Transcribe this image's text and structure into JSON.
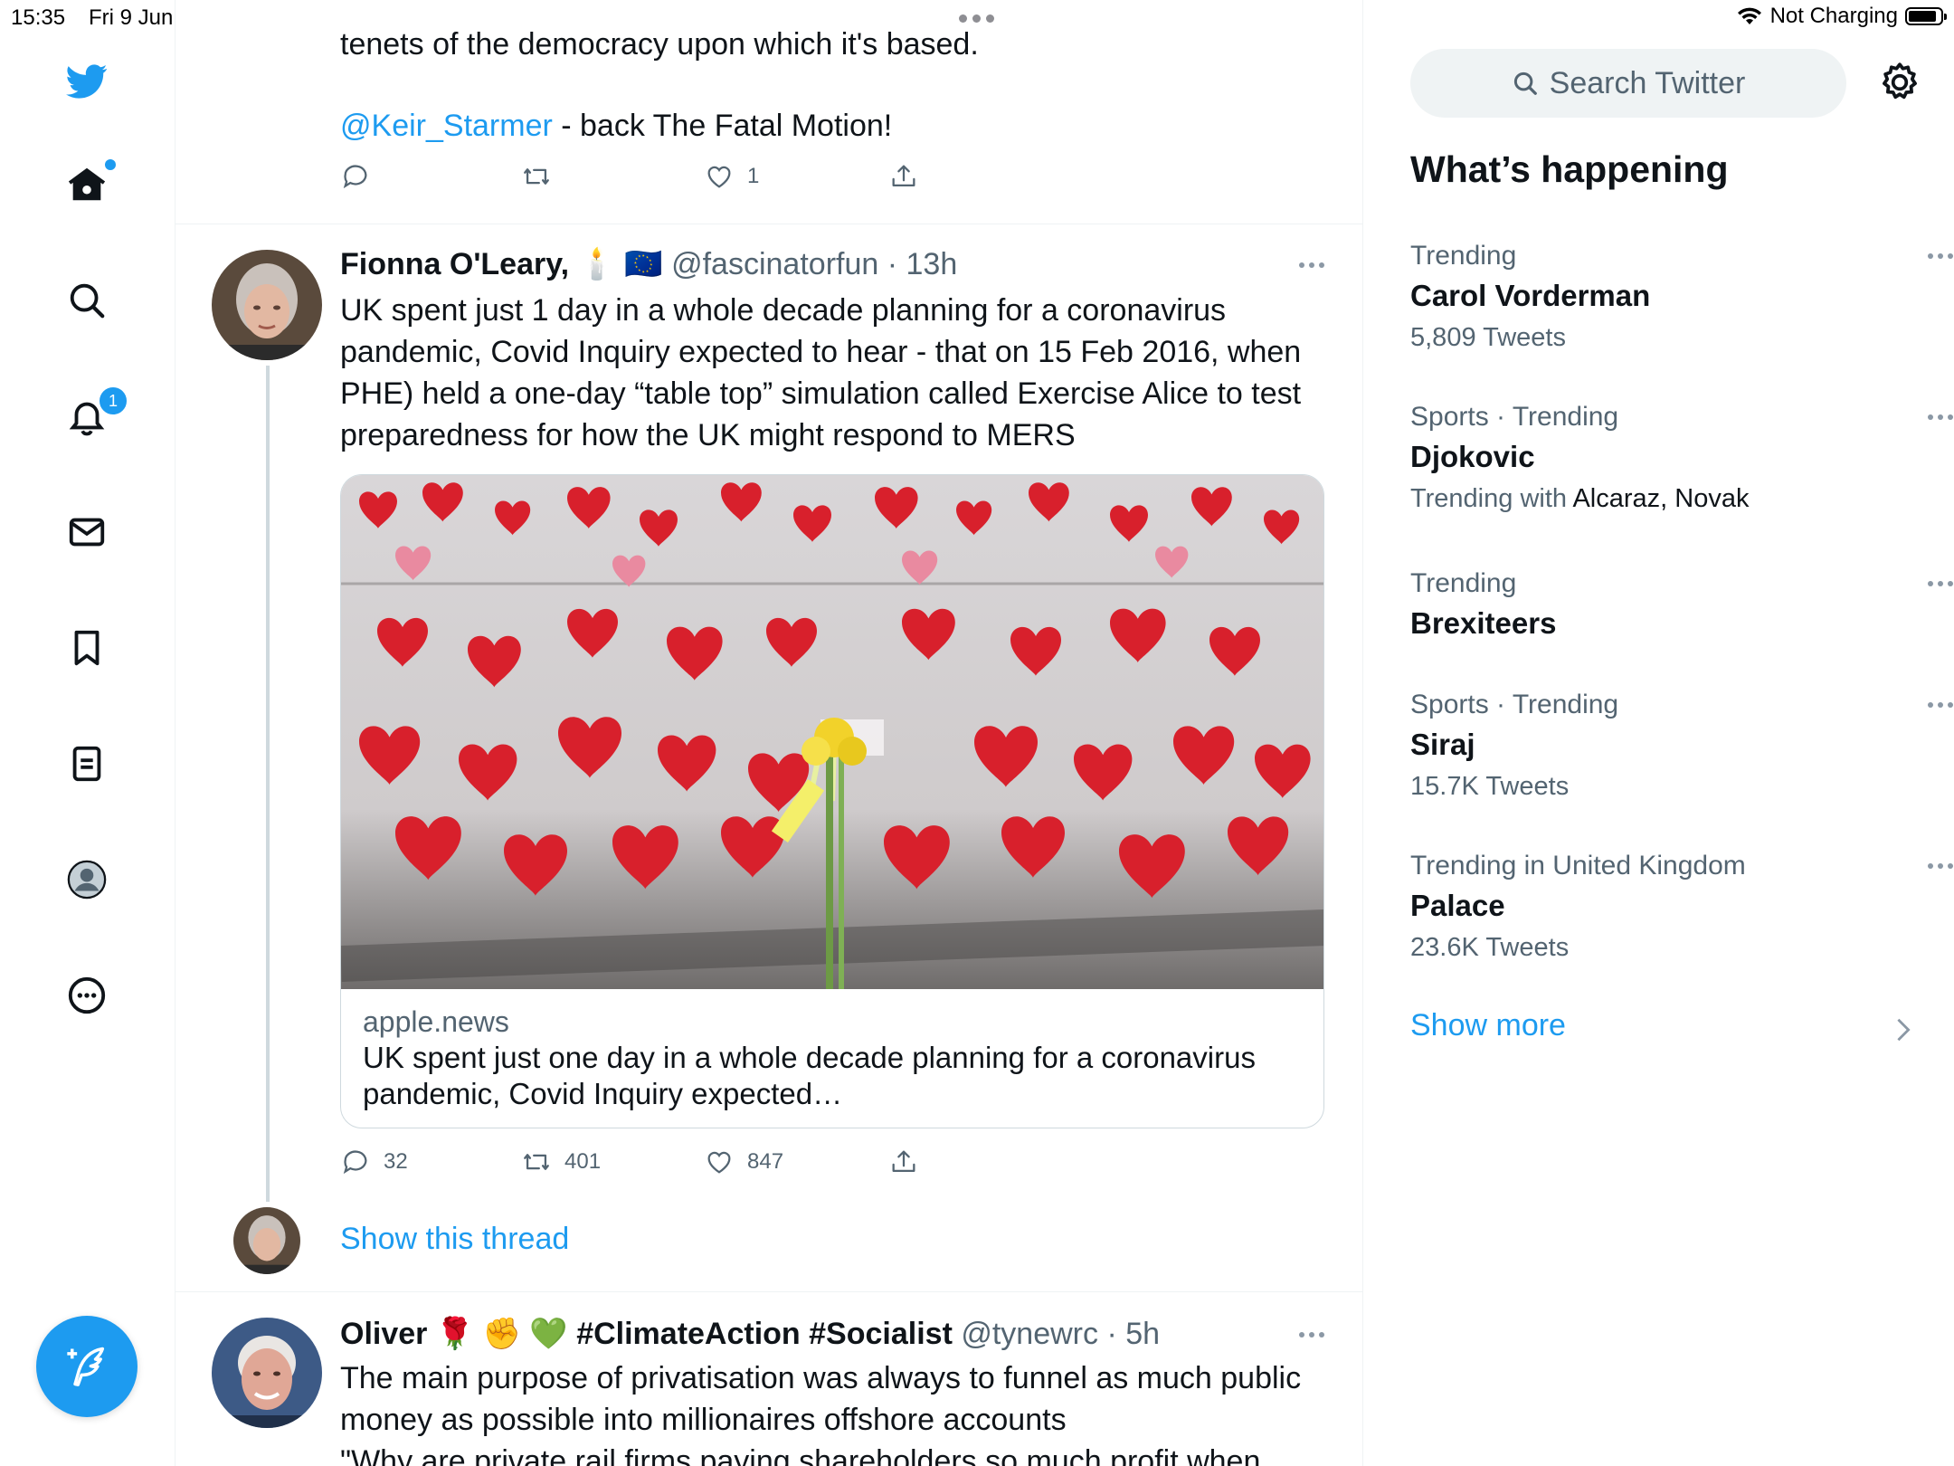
{
  "status": {
    "time": "15:35",
    "date": "Fri 9 Jun",
    "charging": "Not Charging"
  },
  "nav": {
    "notifications_badge": "1",
    "icons": [
      "twitter-logo-icon",
      "home-icon",
      "search-icon",
      "bell-icon",
      "mail-icon",
      "bookmark-icon",
      "lists-icon",
      "profile-icon",
      "more-circle-icon",
      "compose-icon"
    ]
  },
  "tweets": {
    "prev": {
      "text_line": "tenets of the democracy upon which it's based.",
      "mention": "@Keir_Starmer",
      "mention_rest": " - back The Fatal Motion!",
      "likes": "1"
    },
    "main": {
      "name": "Fionna O'Leary,",
      "emoji": "🕯️ 🇪🇺",
      "handle": "@fascinatorfun",
      "time": "13h",
      "text": "UK spent just 1 day in a whole decade planning for a coronavirus pandemic, Covid Inquiry expected to hear - that on 15 Feb 2016, when PHE) held a one-day “table top” simulation called Exercise Alice to test preparedness for how the UK might respond to MERS",
      "card_domain": "apple.news",
      "card_title": "UK spent just one day in a whole decade planning for a coronavirus pandemic, Covid Inquiry expected…",
      "replies": "32",
      "retweets": "401",
      "likes": "847",
      "show_thread": "Show this thread"
    },
    "next": {
      "name": "Oliver",
      "emoji": "🌹 ✊ 💚",
      "tags": "#ClimateAction #Socialist",
      "handle": "@tynewrc",
      "time": "5h",
      "text": "The main purpose of privatisation was always to funnel as much public money as possible into millionaires offshore accounts",
      "text2": "\"Why are private rail firms paying shareholders so much profit when"
    }
  },
  "sidebar": {
    "search_placeholder": "Search Twitter",
    "title": "What’s happening",
    "trends": [
      {
        "context": "Trending",
        "name": "Carol Vorderman",
        "count": "5,809 Tweets"
      },
      {
        "context": "Sports · Trending",
        "name": "Djokovic",
        "count_prefix": "Trending with ",
        "count_names": "Alcaraz, Novak"
      },
      {
        "context": "Trending",
        "name": "Brexiteers"
      },
      {
        "context": "Sports · Trending",
        "name": "Siraj",
        "count": "15.7K Tweets"
      },
      {
        "context": "Trending in United Kingdom",
        "name": "Palace",
        "count": "23.6K Tweets"
      }
    ],
    "show_more": "Show more"
  },
  "colors": {
    "accent": "#1d9bf0",
    "text": "#0f1419",
    "muted": "#536471"
  }
}
